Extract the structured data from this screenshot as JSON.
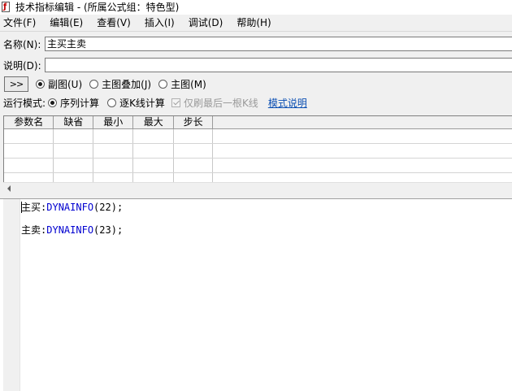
{
  "window": {
    "title": "技术指标编辑 - (所属公式组：特色型)",
    "icon": "formula-icon"
  },
  "menu": [
    "文件(F)",
    "编辑(E)",
    "查看(V)",
    "插入(I)",
    "调试(D)",
    "帮助(H)"
  ],
  "form": {
    "name_label": "名称(N):",
    "name_value": "主买主卖",
    "desc_label": "说明(D):",
    "desc_value": ""
  },
  "toolbar": {
    "expand_button": ">>",
    "display_options": [
      {
        "label": "副图(U)",
        "selected": true
      },
      {
        "label": "主图叠加(J)",
        "selected": false
      },
      {
        "label": "主图(M)",
        "selected": false
      }
    ]
  },
  "run_mode": {
    "label": "运行模式:",
    "options": [
      {
        "label": "序列计算",
        "selected": true
      },
      {
        "label": "逐K线计算",
        "selected": false
      }
    ],
    "last_bar_checkbox": {
      "label": "仅刷最后一根K线",
      "checked": true,
      "disabled": true
    },
    "help_link": "模式说明"
  },
  "params_table": {
    "columns": [
      "参数名",
      "缺省",
      "最小",
      "最大",
      "步长"
    ],
    "rows": [
      [
        "",
        "",
        "",
        "",
        ""
      ],
      [
        "",
        "",
        "",
        "",
        ""
      ],
      [
        "",
        "",
        "",
        "",
        ""
      ],
      [
        "",
        "",
        "",
        "",
        ""
      ]
    ]
  },
  "editor": {
    "lines": [
      {
        "var": "主买",
        "sep": ":",
        "func": "DYNAINFO",
        "args": "(22);"
      },
      {
        "var": "主卖",
        "sep": ":",
        "func": "DYNAINFO",
        "args": "(23);"
      }
    ]
  },
  "colors": {
    "function": "#0000d0",
    "link": "#0b4fb3",
    "background": "#f0f0f0"
  }
}
